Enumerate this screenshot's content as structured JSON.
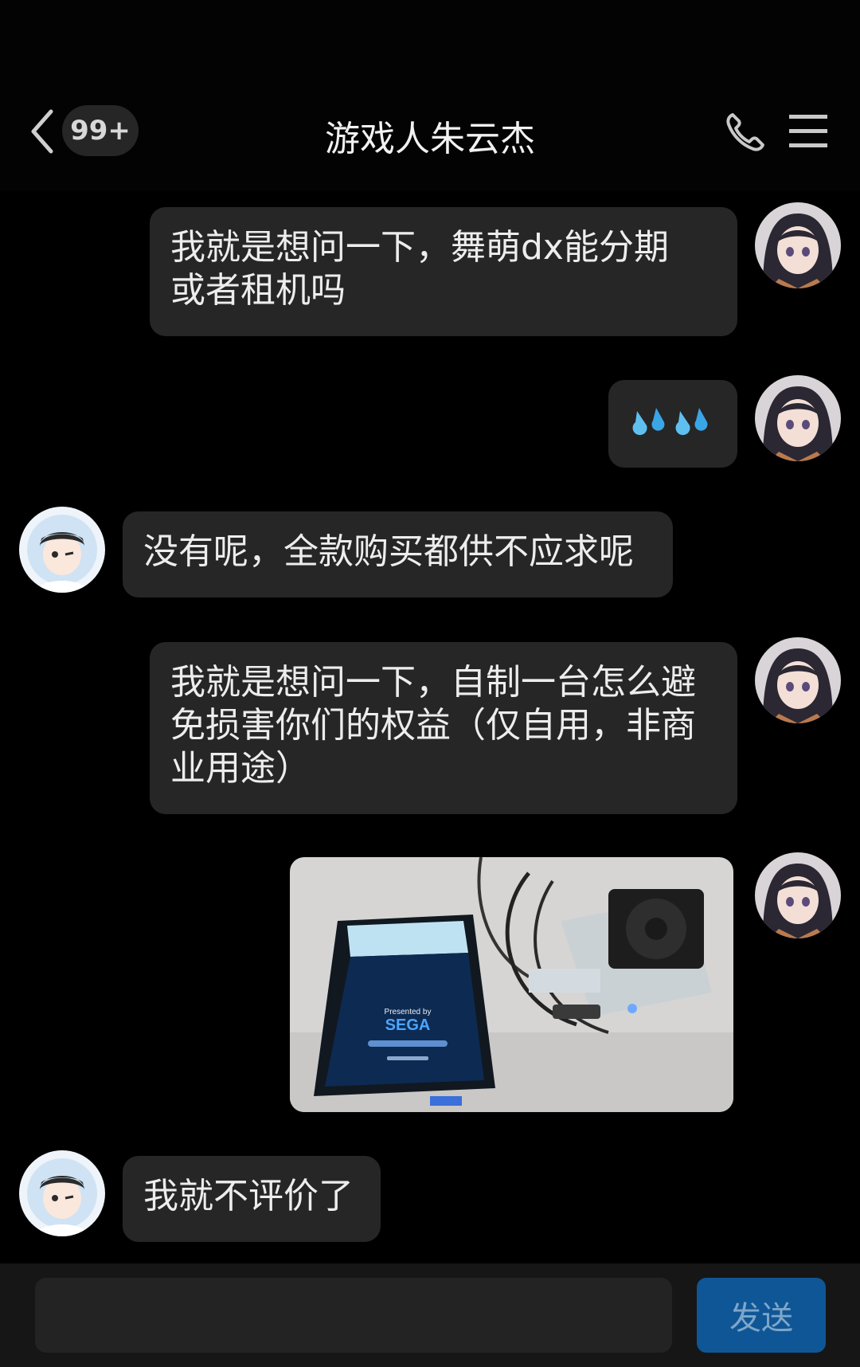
{
  "header": {
    "title": "游戏人朱云杰",
    "unread_badge": "99+",
    "icons": {
      "back": "chevron-left-icon",
      "call": "phone-icon",
      "menu": "menu-icon"
    }
  },
  "messages": [
    {
      "sender": "me",
      "type": "text",
      "text": "我就是想问一下，舞萌dx能分期\n或者租机吗"
    },
    {
      "sender": "me",
      "type": "emoji",
      "emoji": "💦💦"
    },
    {
      "sender": "other",
      "type": "text",
      "text": "没有呢，全款购买都供不应求呢"
    },
    {
      "sender": "me",
      "type": "text",
      "text": "我就是想问一下，自制一台怎么避\n免损害你们的权益（仅自用，非商\n业用途）"
    },
    {
      "sender": "me",
      "type": "image",
      "image_text": {
        "line1": "Presented by",
        "line2": "SEGA"
      }
    },
    {
      "sender": "other",
      "type": "text",
      "text": "我就不评价了"
    }
  ],
  "composer": {
    "send_label": "发送"
  },
  "colors": {
    "bubble": "#262626",
    "send": "#0f5696",
    "background": "#000000"
  }
}
